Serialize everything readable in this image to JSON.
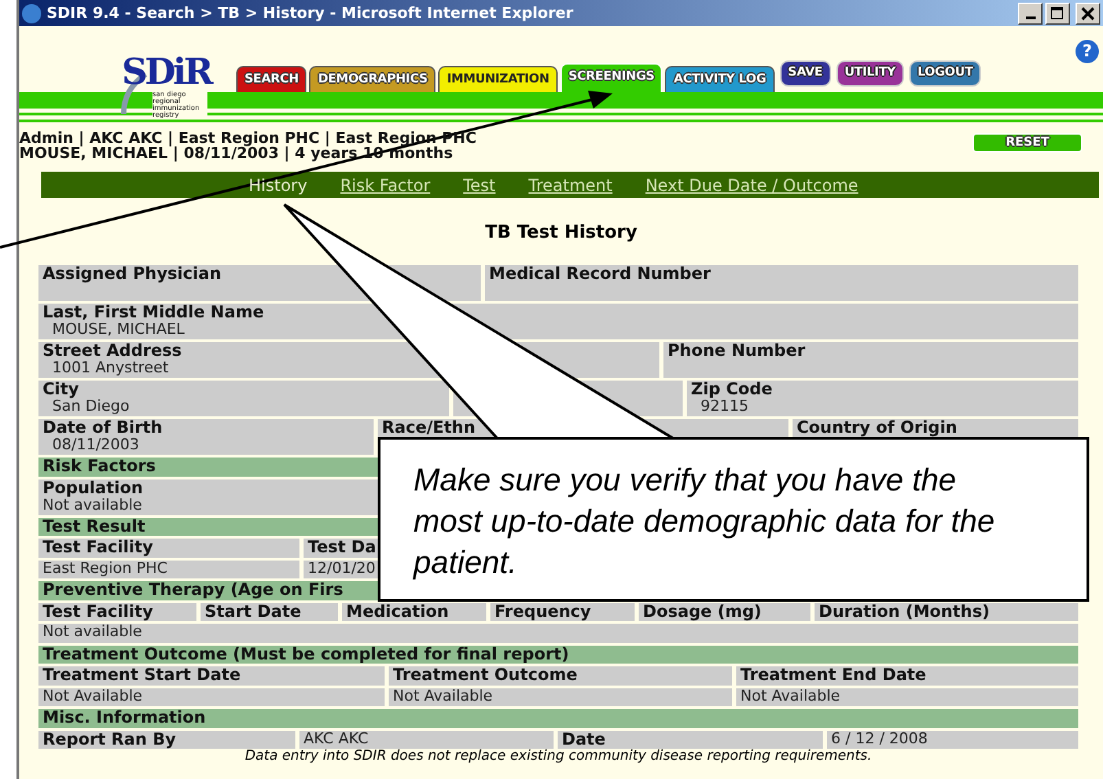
{
  "window": {
    "title": "SDIR 9.4 - Search > TB > History - Microsoft Internet Explorer"
  },
  "header": {
    "help": "?",
    "logo": {
      "text": "SDiR",
      "tagline": "san diego regional immunization registry"
    },
    "nav": [
      {
        "label": "SEARCH",
        "kind": "tab",
        "color": "#cc1111",
        "selected": false
      },
      {
        "label": "DEMOGRAPHICS",
        "kind": "tab",
        "color": "#c49a22",
        "selected": false
      },
      {
        "label": "IMMUNIZATION",
        "kind": "tab",
        "color": "#f2ee00",
        "selected": false
      },
      {
        "label": "SCREENINGS",
        "kind": "tab",
        "color": "#33cc00",
        "selected": true
      },
      {
        "label": "ACTIVITY LOG",
        "kind": "tab",
        "color": "#2299cc",
        "selected": false
      },
      {
        "label": "SAVE",
        "kind": "button",
        "color": "#333399",
        "selected": false
      },
      {
        "label": "UTILITY",
        "kind": "button",
        "color": "#993399",
        "selected": false
      },
      {
        "label": "LOGOUT",
        "kind": "button",
        "color": "#3377aa",
        "selected": false
      }
    ]
  },
  "user_info": [
    "Admin | AKC AKC | East Region PHC | East Region PHC",
    "MOUSE, MICHAEL | 08/11/2003 | 4 years 10 months"
  ],
  "reset_button": "RESET",
  "subnav": [
    {
      "label": "History",
      "selected": true
    },
    {
      "label": "Risk Factor",
      "selected": false
    },
    {
      "label": "Test",
      "selected": false
    },
    {
      "label": "Treatment",
      "selected": false
    },
    {
      "label": "Next Due Date / Outcome",
      "selected": false
    }
  ],
  "page_title": "TB Test History",
  "form": {
    "rows": [
      {
        "kind": "fields",
        "cells": [
          {
            "label": "Assigned Physician"
          },
          {
            "label": "Medical Record Number"
          }
        ]
      },
      {
        "kind": "fields",
        "cells": [
          {
            "label": "Last, First Middle Name",
            "value": "MOUSE, MICHAEL"
          }
        ]
      },
      {
        "kind": "fields",
        "cells": [
          {
            "label": "Street Address",
            "value": "1001 Anystreet"
          },
          {
            "label": "Phone Number"
          }
        ]
      },
      {
        "kind": "fields",
        "cells": [
          {
            "label": "City",
            "value": "San Diego"
          },
          {},
          {
            "label": "Zip Code",
            "value": "92115"
          }
        ]
      },
      {
        "kind": "fields",
        "cells": [
          {
            "label": "Date of Birth",
            "value": "08/11/2003"
          },
          {
            "label": "Race/Ethn"
          },
          {
            "label": "Country of Origin"
          }
        ]
      },
      {
        "kind": "section",
        "label": "Risk Factors"
      },
      {
        "kind": "fields",
        "cells": [
          {
            "label": "Population",
            "value": "Not available"
          }
        ]
      },
      {
        "kind": "section",
        "label": "Test Result"
      },
      {
        "kind": "fields",
        "cells": [
          {
            "label": "Test Facility"
          },
          {
            "label": "Test Da"
          }
        ]
      },
      {
        "kind": "fields",
        "cells": [
          {
            "value": "East Region PHC"
          },
          {
            "value": "12/01/20"
          }
        ]
      },
      {
        "kind": "section",
        "label": "Preventive Therapy (Age on Firs"
      },
      {
        "kind": "fields",
        "cells": [
          {
            "label": "Test Facility"
          },
          {
            "label": "Start Date"
          },
          {
            "label": "Medication"
          },
          {
            "label": "Frequency"
          },
          {
            "label": "Dosage (mg)"
          },
          {
            "label": "Duration (Months)"
          }
        ]
      },
      {
        "kind": "fields",
        "cells": [
          {
            "value": "Not available"
          }
        ]
      },
      {
        "kind": "section",
        "label": "Treatment Outcome (Must be completed for final report)"
      },
      {
        "kind": "fields",
        "cells": [
          {
            "label": "Treatment Start Date"
          },
          {
            "label": "Treatment Outcome"
          },
          {
            "label": "Treatment End Date"
          }
        ]
      },
      {
        "kind": "fields",
        "cells": [
          {
            "value": "Not Available"
          },
          {
            "value": "Not Available"
          },
          {
            "value": "Not Available"
          }
        ]
      },
      {
        "kind": "section",
        "label": "Misc. Information"
      },
      {
        "kind": "fields",
        "cells": [
          {
            "label": "Report Ran By"
          },
          {
            "value": "AKC AKC"
          },
          {
            "label": "Date"
          },
          {
            "value": "6 / 12 / 2008"
          }
        ]
      }
    ]
  },
  "footnote": "Data entry into SDIR does not replace existing community disease reporting requirements.",
  "callout": {
    "text": "Make sure you verify that you have the most up-to-date demographic data for the patient."
  }
}
